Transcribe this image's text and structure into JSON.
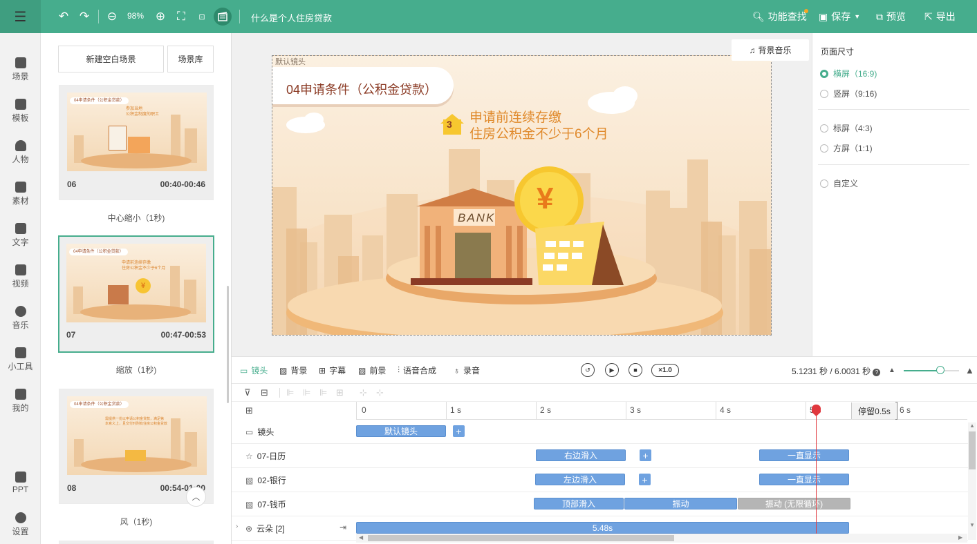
{
  "topbar": {
    "zoom": "98%",
    "doc_title": "什么是个人住房贷款",
    "find_label": "功能查找",
    "save_label": "保存",
    "preview_label": "预览",
    "export_label": "导出"
  },
  "nav": [
    "场景",
    "模板",
    "人物",
    "素材",
    "文字",
    "视频",
    "音乐",
    "小工具",
    "我的",
    "PPT",
    "设置"
  ],
  "scene_panel": {
    "new_blank": "新建空白场景",
    "library": "场景库",
    "cards": [
      {
        "num": "06",
        "time": "00:40-00:46",
        "caption": "中心缩小（1秒)",
        "thumb_title": "04申请条件（公积金贷款）",
        "thumb_text": "参加当地\n公积金制度的职工"
      },
      {
        "num": "07",
        "time": "00:47-00:53",
        "caption": "缩放（1秒)",
        "thumb_title": "04申请条件（公积金贷款）",
        "thumb_text": "申请前连续存缴\n住房公积金不少于6个月"
      },
      {
        "num": "08",
        "time": "00:54-01:00",
        "caption": "风（1秒)",
        "thumb_title": "04申请条件（公积金贷款）",
        "thumb_text": "需提供一份以申请公积金贷款，满足第\n本意义上，且交付时附有住房公积金贷款"
      }
    ]
  },
  "stage": {
    "camera_name": "默认镜头",
    "title": "04申请条件（公积金贷款）",
    "badge_num": "3",
    "line1": "申请前连续存缴",
    "line2": "住房公积金不少于6个月",
    "bank_sign": "BANK",
    "coin": "¥",
    "bgm_label": "背景音乐"
  },
  "props": {
    "title": "页面尺寸",
    "options": [
      {
        "label": "横屏（16:9)",
        "checked": true
      },
      {
        "label": "竖屏（9:16)",
        "checked": false
      },
      {
        "label": "标屏（4:3)",
        "checked": false
      },
      {
        "label": "方屏（1:1)",
        "checked": false
      },
      {
        "label": "自定义",
        "checked": false
      }
    ]
  },
  "timeline_tabs": [
    "镜头",
    "背景",
    "字幕",
    "前景",
    "语音合成",
    "录音"
  ],
  "playback": {
    "speed": "×1.0",
    "time": "5.1231 秒 / 6.0031 秒"
  },
  "ruler": {
    "labels": [
      "0",
      "1 s",
      "2 s",
      "3 s",
      "4 s",
      "5",
      "6 s"
    ],
    "pause": "停留0.5s"
  },
  "tracks": [
    {
      "name": "镜头",
      "clips": [
        {
          "label": "默认镜头"
        }
      ]
    },
    {
      "name": "07-日历",
      "clips": [
        {
          "label": "右边滑入"
        },
        {
          "label": "一直显示"
        }
      ]
    },
    {
      "name": "02-银行",
      "clips": [
        {
          "label": "左边滑入"
        },
        {
          "label": "一直显示"
        }
      ]
    },
    {
      "name": "07-钱币",
      "clips": [
        {
          "label": "顶部滑入"
        },
        {
          "label": "振动"
        },
        {
          "label": "振动 (无限循环)"
        }
      ]
    },
    {
      "name": "云朵 [2]",
      "clips": [
        {
          "label": "5.48s"
        }
      ]
    }
  ],
  "colors": {
    "accent": "#46ad8d",
    "clip": "#6fa2e0",
    "playhead": "#e0383e"
  }
}
